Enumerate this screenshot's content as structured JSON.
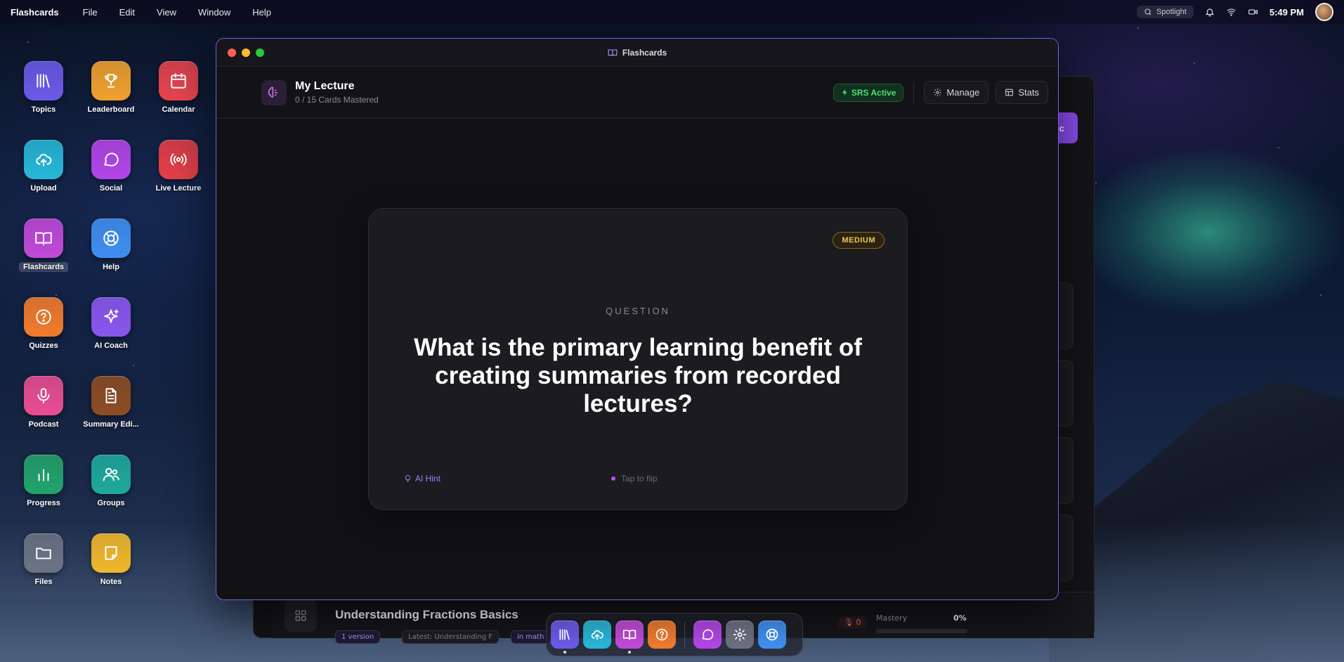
{
  "menubar": {
    "app_name": "Flashcards",
    "menus": [
      "File",
      "Edit",
      "View",
      "Window",
      "Help"
    ],
    "spotlight": "Spotlight",
    "time": "5:49 PM"
  },
  "desktop": [
    {
      "label": "Topics",
      "icon": "library-icon",
      "color": "#6a5ae8"
    },
    {
      "label": "Leaderboard",
      "icon": "trophy-icon",
      "color": "#f1a02f"
    },
    {
      "label": "Calendar",
      "icon": "calendar-icon",
      "color": "#e8454f"
    },
    {
      "label": "Upload",
      "icon": "upload-cloud-icon",
      "color": "#27b7d8"
    },
    {
      "label": "Social",
      "icon": "chat-bubble-icon",
      "color": "#b345e8"
    },
    {
      "label": "Live Lecture",
      "icon": "broadcast-icon",
      "color": "#e53f48"
    },
    {
      "label": "Flashcards",
      "icon": "book-open-icon",
      "color": "#c249d9"
    },
    {
      "label": "Help",
      "icon": "lifebuoy-icon",
      "color": "#3f8ff0"
    },
    {
      "label": "Quizzes",
      "icon": "question-circle-icon",
      "color": "#f27b2c"
    },
    {
      "label": "AI Coach",
      "icon": "sparkles-icon",
      "color": "#8a57ee"
    },
    {
      "label": "Podcast",
      "icon": "microphone-icon",
      "color": "#ea4d93"
    },
    {
      "label": "Summary Edi...",
      "icon": "document-icon",
      "color": "#8d4d23"
    },
    {
      "label": "Progress",
      "icon": "bar-chart-icon",
      "color": "#22a36b"
    },
    {
      "label": "Groups",
      "icon": "users-icon",
      "color": "#1fa99b"
    },
    {
      "label": "Files",
      "icon": "folder-icon",
      "color": "#6b7384"
    },
    {
      "label": "Notes",
      "icon": "note-icon",
      "color": "#f0b72a"
    }
  ],
  "window": {
    "title": "Flashcards",
    "deck_title": "My Lecture",
    "deck_subtitle": "0 / 15 Cards Mastered",
    "srs_badge": "SRS Active",
    "manage_label": "Manage",
    "stats_label": "Stats"
  },
  "card": {
    "difficulty": "MEDIUM",
    "side_label": "QUESTION",
    "question": "What is the primary learning benefit of creating summaries from recorded lectures?",
    "hint_label": "AI Hint",
    "flip_label": "Tap to flip"
  },
  "background_window": {
    "button_label": "ic",
    "row_title": "Understanding Fractions Basics",
    "chips": [
      "1 version",
      "Latest: Understanding F",
      "in math"
    ],
    "mic_count": "0",
    "mastery_label": "Mastery",
    "mastery_value": "0%",
    "mastery_fraction": 0
  },
  "dock": [
    {
      "icon": "library-icon",
      "color": "#6a5ae8",
      "active": true
    },
    {
      "icon": "upload-cloud-icon",
      "color": "#27b7d8",
      "active": false
    },
    {
      "icon": "book-open-icon",
      "color": "#c249d9",
      "active": true
    },
    {
      "icon": "question-circle-icon",
      "color": "#f27b2c",
      "active": false
    },
    {
      "icon": "chat-bubble-icon",
      "color": "#b345e8",
      "active": false
    },
    {
      "icon": "gear-icon",
      "color": "#6b7080",
      "active": false
    },
    {
      "icon": "lifebuoy-icon",
      "color": "#3f8ff0",
      "active": false
    }
  ]
}
